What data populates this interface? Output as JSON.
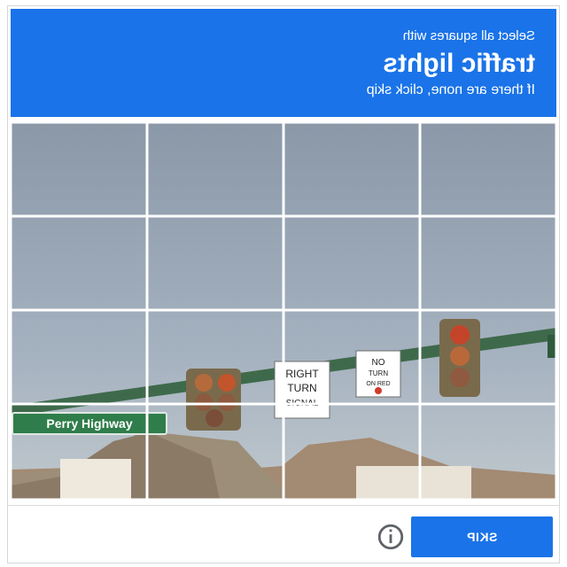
{
  "header": {
    "line1": "Select all squares with",
    "target": "traffic lights",
    "line3": "If there are none, click skip",
    "color": "#1a73e8"
  },
  "grid": {
    "rows": 4,
    "cols": 4
  },
  "scene_text": {
    "street_sign": "Perry Highway",
    "sign_a_line1": "RIGHT",
    "sign_a_line2": "TURN",
    "sign_a_line3": "SIGNAL",
    "sign_b_line1": "NO",
    "sign_b_line2": "TURN",
    "sign_b_line3": "ON RED"
  },
  "footer": {
    "reload_icon": "reload-icon",
    "audio_icon": "headphones-icon",
    "info_icon": "info-icon",
    "skip_label": "SKIP"
  }
}
